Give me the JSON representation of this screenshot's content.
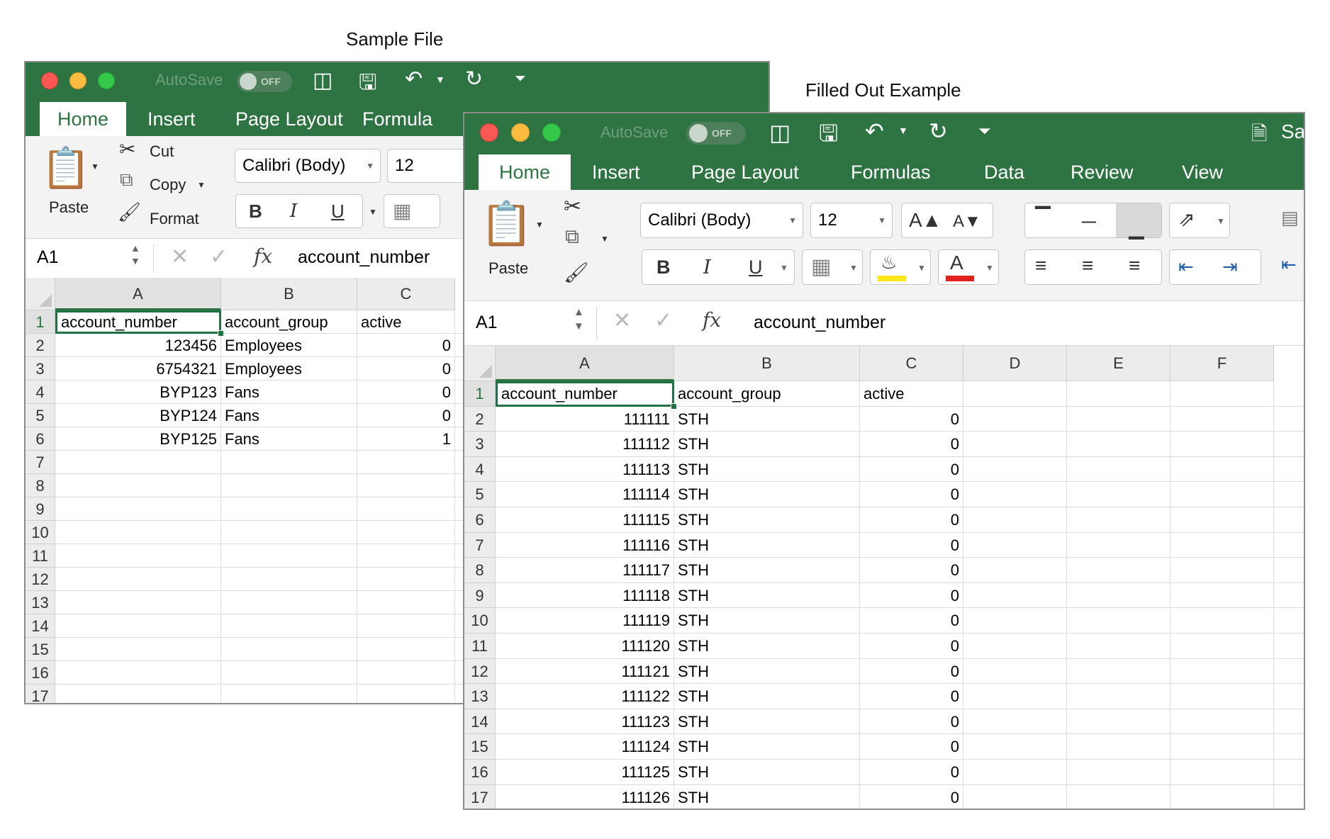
{
  "captions": {
    "sample": "Sample File",
    "filled": "Filled Out Example"
  },
  "colors": {
    "excel_green": "#2e7342",
    "ribbon_bg": "#f3f3f3",
    "highlight_yellow": "#ffe817",
    "font_red": "#e0211d"
  },
  "common": {
    "autosave_label": "AutoSave",
    "toggle_label": "OFF",
    "tabs": [
      "Home",
      "Insert",
      "Page Layout",
      "Formulas",
      "Data",
      "Review",
      "View"
    ],
    "font_name": "Calibri (Body)",
    "font_size": "12",
    "paste_label": "Paste",
    "bold": "B",
    "italic": "I",
    "underline": "U",
    "cell_ref": "A1",
    "formula_value": "account_number",
    "doc_title_fragment": "Sa"
  },
  "sample_window": {
    "clipboard": {
      "cut": "Cut",
      "copy": "Copy",
      "format": "Format"
    },
    "visible_tabs": [
      "Home",
      "Insert",
      "Page Layout",
      "Formula"
    ],
    "columns": [
      "A",
      "B",
      "C"
    ],
    "row_numbers": [
      "1",
      "2",
      "3",
      "4",
      "5",
      "6",
      "7",
      "8",
      "9",
      "10",
      "11",
      "12",
      "13",
      "14",
      "15",
      "16",
      "17"
    ],
    "rows": [
      {
        "a": "account_number",
        "b": "account_group",
        "c": "active"
      },
      {
        "a": "123456",
        "b": "Employees",
        "c": "0"
      },
      {
        "a": "6754321",
        "b": "Employees",
        "c": "0"
      },
      {
        "a": "BYP123",
        "b": "Fans",
        "c": "0"
      },
      {
        "a": "BYP124",
        "b": "Fans",
        "c": "0"
      },
      {
        "a": "BYP125",
        "b": "Fans",
        "c": "1"
      }
    ]
  },
  "filled_window": {
    "columns": [
      "A",
      "B",
      "C",
      "D",
      "E",
      "F"
    ],
    "row_numbers": [
      "1",
      "2",
      "3",
      "4",
      "5",
      "6",
      "7",
      "8",
      "9",
      "10",
      "11",
      "12",
      "13",
      "14",
      "15",
      "16",
      "17"
    ],
    "rows": [
      {
        "a": "account_number",
        "b": "account_group",
        "c": "active"
      },
      {
        "a": "111111",
        "b": "STH",
        "c": "0"
      },
      {
        "a": "111112",
        "b": "STH",
        "c": "0"
      },
      {
        "a": "111113",
        "b": "STH",
        "c": "0"
      },
      {
        "a": "111114",
        "b": "STH",
        "c": "0"
      },
      {
        "a": "111115",
        "b": "STH",
        "c": "0"
      },
      {
        "a": "111116",
        "b": "STH",
        "c": "0"
      },
      {
        "a": "111117",
        "b": "STH",
        "c": "0"
      },
      {
        "a": "111118",
        "b": "STH",
        "c": "0"
      },
      {
        "a": "111119",
        "b": "STH",
        "c": "0"
      },
      {
        "a": "111120",
        "b": "STH",
        "c": "0"
      },
      {
        "a": "111121",
        "b": "STH",
        "c": "0"
      },
      {
        "a": "111122",
        "b": "STH",
        "c": "0"
      },
      {
        "a": "111123",
        "b": "STH",
        "c": "0"
      },
      {
        "a": "111124",
        "b": "STH",
        "c": "0"
      },
      {
        "a": "111125",
        "b": "STH",
        "c": "0"
      },
      {
        "a": "111126",
        "b": "STH",
        "c": "0"
      }
    ]
  }
}
